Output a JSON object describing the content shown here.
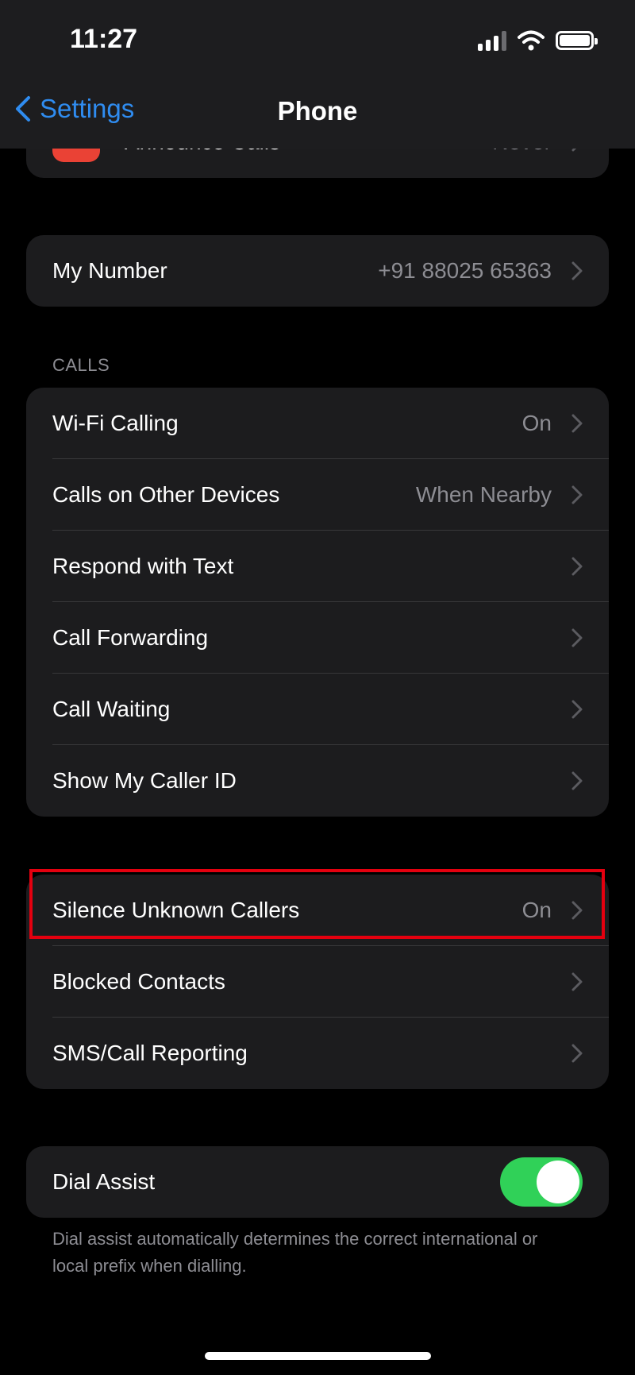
{
  "status_bar": {
    "time": "11:27"
  },
  "nav": {
    "back_label": "Settings",
    "title": "Phone"
  },
  "partial_row": {
    "label": "Announce Calls",
    "value": "Never"
  },
  "my_number": {
    "label": "My Number",
    "value": "+91 88025 65363"
  },
  "calls_section": {
    "header": "CALLS",
    "rows": [
      {
        "label": "Wi-Fi Calling",
        "value": "On"
      },
      {
        "label": "Calls on Other Devices",
        "value": "When Nearby"
      },
      {
        "label": "Respond with Text",
        "value": ""
      },
      {
        "label": "Call Forwarding",
        "value": ""
      },
      {
        "label": "Call Waiting",
        "value": ""
      },
      {
        "label": "Show My Caller ID",
        "value": ""
      }
    ]
  },
  "blocking_section": {
    "rows": [
      {
        "label": "Silence Unknown Callers",
        "value": "On"
      },
      {
        "label": "Blocked Contacts",
        "value": ""
      },
      {
        "label": "SMS/Call Reporting",
        "value": ""
      }
    ]
  },
  "dial_assist": {
    "label": "Dial Assist",
    "enabled": true,
    "footer": "Dial assist automatically determines the correct international or local prefix when dialling."
  },
  "colors": {
    "accent": "#2f8cf0",
    "toggle_on": "#30d158",
    "highlight": "#e4000f",
    "app_icon": "#ea4235"
  }
}
